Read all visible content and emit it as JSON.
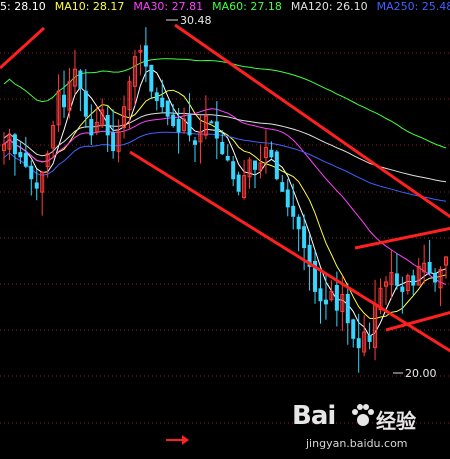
{
  "legend": {
    "ma5": "5: 28.10",
    "ma10": "MA10: 28.17",
    "ma30": "MA30: 27.81",
    "ma60": "MA60: 27.18",
    "ma120": "MA120: 26.10",
    "ma250": "MA250: 25.48"
  },
  "colors": {
    "background": "#000000",
    "up": "#ff3b3b",
    "down": "#38d6ff",
    "ma5": "#ffffff",
    "ma10": "#ffff40",
    "ma30": "#ff40ff",
    "ma60": "#40ff40",
    "ma120": "#e0e0e0",
    "ma250": "#4060ff",
    "trendline": "#ff2020",
    "grid": "#8a2020"
  },
  "watermark": {
    "brand": "Bai",
    "brand_cn": "经验",
    "url": "jingyan.baidu.com",
    "icon": "paw-icon"
  },
  "chart_data": {
    "type": "candlestick",
    "annotations": {
      "high_label": "30.48",
      "low_label": "20.00"
    },
    "high": 30.48,
    "low": 20.0,
    "ylim": [
      19.0,
      31.4
    ],
    "grid": true,
    "series": [
      {
        "name": "5",
        "color": "#ffffff",
        "last": 28.1
      },
      {
        "name": "MA10",
        "color": "#ffff40",
        "last": 28.17
      },
      {
        "name": "MA30",
        "color": "#ff40ff",
        "last": 27.81
      },
      {
        "name": "MA60",
        "color": "#40ff40",
        "last": 27.18
      },
      {
        "name": "MA120",
        "color": "#e0e0e0",
        "last": 26.1
      },
      {
        "name": "MA250",
        "color": "#4060ff",
        "last": 25.48
      }
    ],
    "closes": [
      27.3,
      27.6,
      27.0,
      26.9,
      26.6,
      26.2,
      25.9,
      26.4,
      27.0,
      27.9,
      29.0,
      28.5,
      29.3,
      29.7,
      29.1,
      28.2,
      27.6,
      28.0,
      28.4,
      27.6,
      27.1,
      27.7,
      28.5,
      29.3,
      30.1,
      30.3,
      29.8,
      29.0,
      28.7,
      28.5,
      28.2,
      27.9,
      27.7,
      28.1,
      27.6,
      27.3,
      27.7,
      28.2,
      28.0,
      27.5,
      27.0,
      26.8,
      26.2,
      25.8,
      26.3,
      26.8,
      26.5,
      26.7,
      27.2,
      26.9,
      26.2,
      25.8,
      25.3,
      25.0,
      24.6,
      24.0,
      23.4,
      22.6,
      22.3,
      22.2,
      22.6,
      22.0,
      22.5,
      21.6,
      21.1,
      20.8,
      21.3,
      21.0,
      22.2,
      22.7,
      22.9,
      23.2,
      22.8,
      22.6,
      23.1,
      22.8,
      23.4,
      23.5,
      23.2,
      22.9,
      23.3,
      23.7
    ],
    "trendlines": [
      {
        "label": "upper-channel"
      },
      {
        "label": "lower-channel"
      },
      {
        "label": "upper-left-fragment"
      },
      {
        "label": "right-upper-line"
      },
      {
        "label": "right-lower-line"
      }
    ]
  }
}
